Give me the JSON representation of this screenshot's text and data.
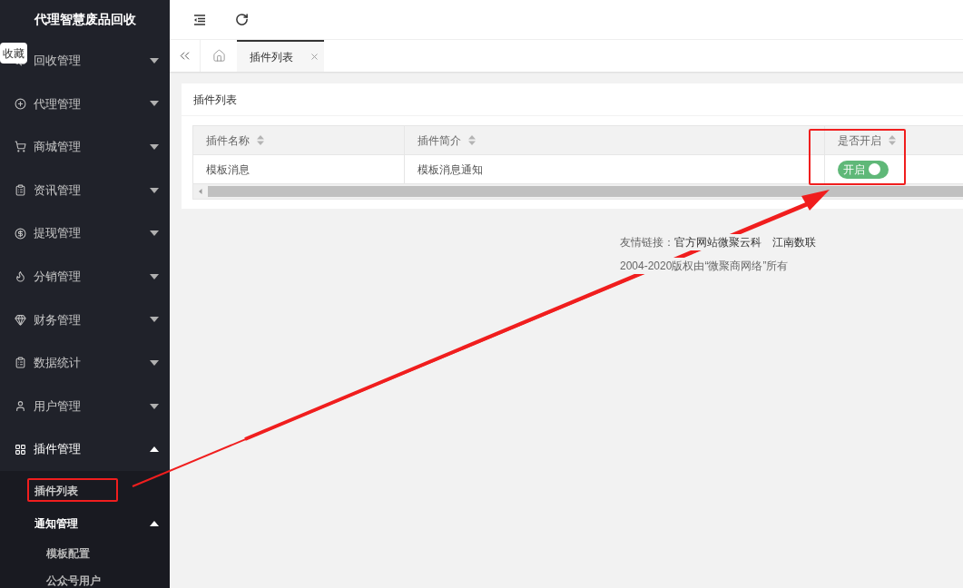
{
  "sidebar": {
    "title": "代理智慧废品回收",
    "tooltip": "收藏",
    "items": [
      {
        "label": "回收管理",
        "expanded": false
      },
      {
        "label": "代理管理",
        "expanded": false
      },
      {
        "label": "商城管理",
        "expanded": false
      },
      {
        "label": "资讯管理",
        "expanded": false
      },
      {
        "label": "提现管理",
        "expanded": false
      },
      {
        "label": "分销管理",
        "expanded": false
      },
      {
        "label": "财务管理",
        "expanded": false
      },
      {
        "label": "数据统计",
        "expanded": false
      },
      {
        "label": "用户管理",
        "expanded": false
      },
      {
        "label": "插件管理",
        "expanded": true,
        "children": [
          {
            "label": "插件列表",
            "expanded": false
          },
          {
            "label": "通知管理",
            "expanded": true,
            "children": [
              {
                "label": "模板配置"
              },
              {
                "label": "公众号用户"
              }
            ]
          }
        ]
      }
    ]
  },
  "tabs": [
    {
      "label": "插件列表",
      "selected": true
    }
  ],
  "card": {
    "title": "插件列表",
    "table": {
      "columns": [
        "插件名称",
        "插件简介",
        "是否开启"
      ],
      "rows": [
        {
          "cells": [
            "模板消息",
            "模板消息通知"
          ],
          "toggle": {
            "on": true,
            "label": "开启"
          }
        }
      ]
    }
  },
  "footer": {
    "links_label": "友情链接：",
    "links": [
      "官方网站微聚云科",
      "江南数联"
    ],
    "copyright": "2004-2020版权由“微聚商网络”所有"
  }
}
